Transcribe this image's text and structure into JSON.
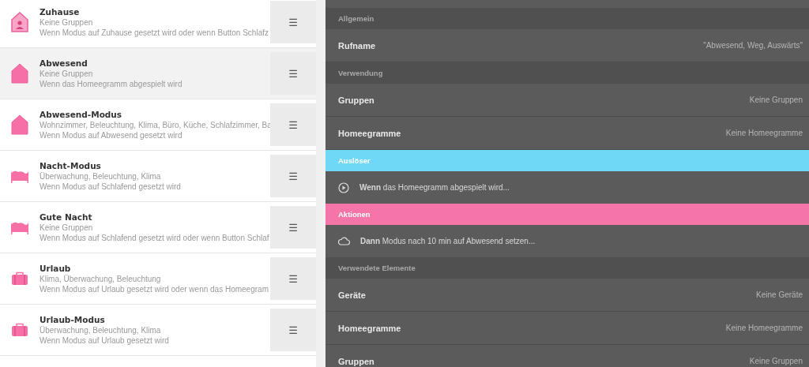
{
  "list": [
    {
      "kind": "home",
      "title": "Zuhause",
      "groups": "Keine Gruppen",
      "trigger": "Wenn Modus auf Zuhause gesetzt wird oder wenn Button Schlafz",
      "selected": false
    },
    {
      "kind": "house",
      "title": "Abwesend",
      "groups": "Keine Gruppen",
      "trigger": "Wenn das Homeegramm abgespielt wird",
      "selected": true
    },
    {
      "kind": "house",
      "title": "Abwesend-Modus",
      "groups": "Wohnzimmer, Beleuchtung, Klima, Büro, Küche, Schlafzimmer, Ba",
      "trigger": "Wenn Modus auf Abwesend gesetzt wird",
      "selected": false
    },
    {
      "kind": "bed",
      "title": "Nacht-Modus",
      "groups": "Überwachung, Beleuchtung, Klima",
      "trigger": "Wenn Modus auf Schlafend gesetzt wird",
      "selected": false
    },
    {
      "kind": "bed",
      "title": "Gute Nacht",
      "groups": "Keine Gruppen",
      "trigger": "Wenn Modus auf Schlafend gesetzt wird oder wenn Button Schlaf",
      "selected": false
    },
    {
      "kind": "suitcase",
      "title": "Urlaub",
      "groups": "Klima, Überwachung, Beleuchtung",
      "trigger": "Wenn Modus auf Urlaub gesetzt wird oder wenn das Homeegram",
      "selected": false
    },
    {
      "kind": "suitcase",
      "title": "Urlaub-Modus",
      "groups": "Überwachung, Beleuchtung, Klima",
      "trigger": "Wenn Modus auf Urlaub gesetzt wird",
      "selected": false
    }
  ],
  "menu_button": "☰",
  "details": [
    {
      "title": "Allgemein",
      "color": "#505050",
      "accent": false,
      "items": [
        {
          "kind": "property",
          "label": "Rufname",
          "value": "\"Abwesend, Weg, Auswärts\""
        }
      ]
    },
    {
      "title": "Verwendung",
      "color": "#505050",
      "accent": false,
      "items": [
        {
          "kind": "property",
          "label": "Gruppen",
          "value": "Keine Gruppen"
        },
        {
          "kind": "property",
          "label": "Homeegramme",
          "value": "Keine Homeegramme"
        }
      ]
    },
    {
      "title": "Auslöser",
      "color": "#6fd8f6",
      "accent": true,
      "items": [
        {
          "kind": "trigger",
          "text": "**Wenn** das Homeegramm abgespielt wird..."
        }
      ]
    },
    {
      "title": "Aktionen",
      "color": "#f675a8",
      "accent": true,
      "items": [
        {
          "kind": "action",
          "text": "**Dann** Modus nach 10 min auf Abwesend setzen..."
        }
      ]
    },
    {
      "title": "Verwendete Elemente",
      "color": "#505050",
      "accent": false,
      "items": [
        {
          "kind": "property",
          "label": "Geräte",
          "value": "Keine Geräte"
        },
        {
          "kind": "property",
          "label": "Homeegramme",
          "value": "Keine Homeegramme"
        },
        {
          "kind": "property",
          "label": "Gruppen",
          "value": "Keine Gruppen"
        }
      ]
    }
  ]
}
